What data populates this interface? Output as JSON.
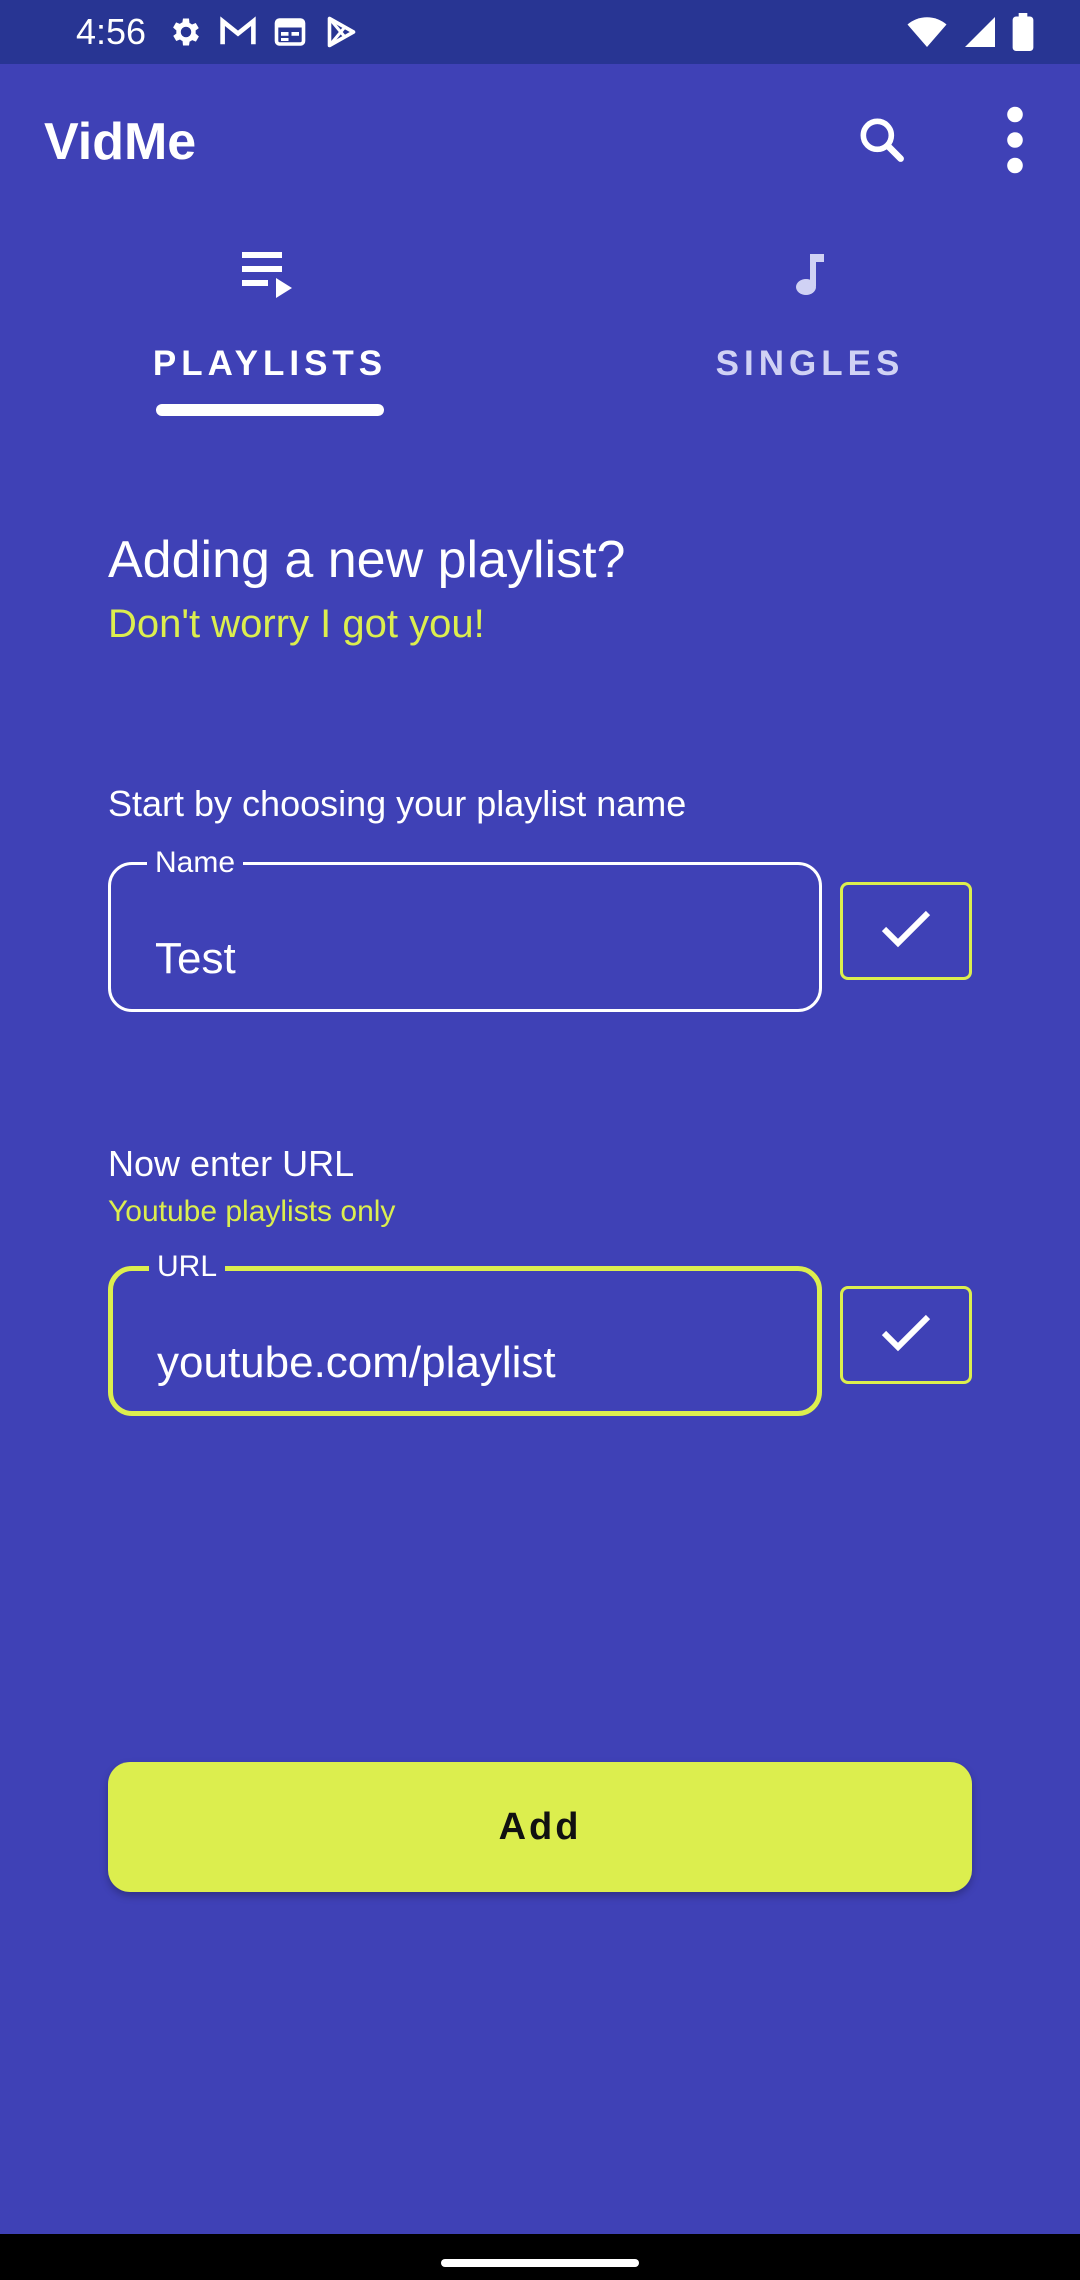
{
  "status_bar": {
    "time": "4:56",
    "left_icons": [
      "settings-icon",
      "gmail-icon",
      "calendar-icon",
      "play-store-icon"
    ],
    "right_icons": [
      "wifi-icon",
      "signal-icon",
      "battery-icon"
    ]
  },
  "app_bar": {
    "title": "VidMe",
    "actions": [
      "search-icon",
      "more-vert-icon"
    ]
  },
  "tabs": [
    {
      "label": "PLAYLISTS",
      "icon": "playlist-play-icon",
      "selected": true
    },
    {
      "label": "SINGLES",
      "icon": "music-note-icon",
      "selected": false
    }
  ],
  "form": {
    "heading": "Adding a new playlist?",
    "subheading": "Don't worry I got you!",
    "name_section": {
      "label": "Start by choosing your playlist name",
      "field_label": "Name",
      "value": "Test"
    },
    "url_section": {
      "label": "Now enter URL",
      "hint": "Youtube playlists only",
      "field_label": "URL",
      "value": "youtube.com/playlist"
    },
    "add_button_label": "Add"
  },
  "colors": {
    "background": "#3F41B6",
    "status_bar": "#283593",
    "accent": "#DCEE4E",
    "text_on_accent": "#111111",
    "text": "#FFFFFF",
    "inactive_tab": "#D0D2F4"
  }
}
